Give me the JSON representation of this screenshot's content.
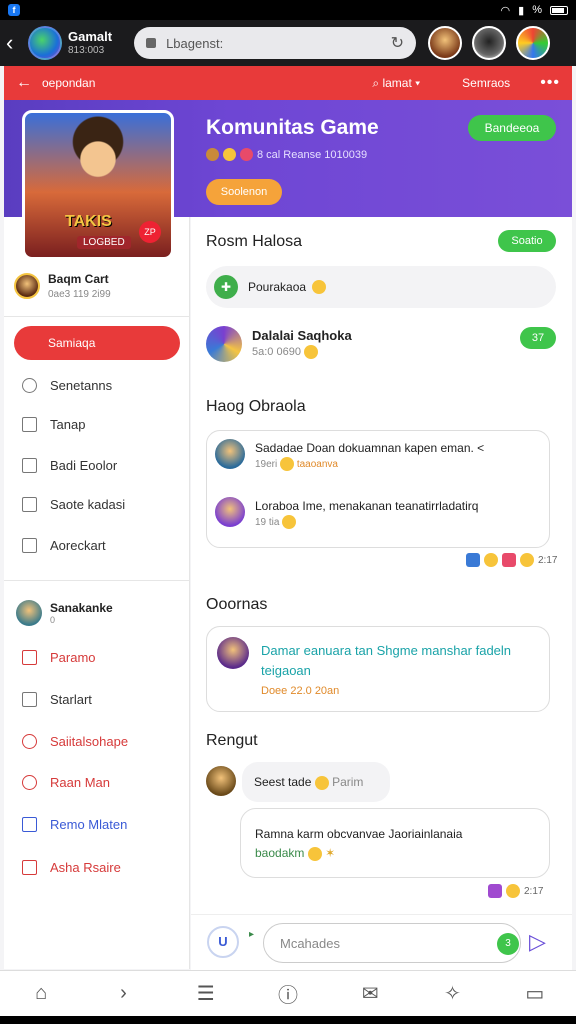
{
  "status_bar": {
    "app_badge": "f",
    "battery": "%"
  },
  "browser": {
    "app_name": "Gamalt",
    "app_sub": "813:003",
    "url": "Lbagenst:"
  },
  "header": {
    "back_label": "oepondan",
    "search_label": "lamat",
    "settings_label": "Semraos",
    "more_label": "•••"
  },
  "banner": {
    "title": "Komunitas Game",
    "join_label": "Bandeeoa",
    "stats": "8 cal Reanse 1010039",
    "genre_label": "Soolenon",
    "cover_game_name": "TAKIS",
    "cover_game_sub": "LOGBED",
    "cover_badge": "ZP"
  },
  "sidebar": {
    "user_name": "Baqm Cart",
    "user_stats": "0ae3 119 2i99",
    "primary_button": "Samiaqa",
    "items": [
      {
        "label": "Senetanns",
        "icon": "location-icon"
      },
      {
        "label": "Tanap",
        "icon": "mail-icon"
      },
      {
        "label": "Badi Eoolor",
        "icon": "list-icon"
      },
      {
        "label": "Saote kadasi",
        "icon": "document-icon"
      },
      {
        "label": "Aoreckart",
        "icon": "home-icon"
      }
    ],
    "section_user": "Sanakanke",
    "section_sub": "0",
    "section_items": [
      {
        "label": "Paramo",
        "icon": "home-icon",
        "color": "red"
      },
      {
        "label": "Starlart",
        "icon": "upload-icon",
        "color": "gray"
      },
      {
        "label": "Saiitalsohape",
        "icon": "clock-icon",
        "color": "red"
      },
      {
        "label": "Raan Man",
        "icon": "alert-icon",
        "color": "red"
      },
      {
        "label": "Remo Mlaten",
        "icon": "book-icon",
        "color": "blue"
      },
      {
        "label": "Asha Rsaire",
        "icon": "grid-icon",
        "color": "red"
      }
    ]
  },
  "main": {
    "section1_title": "Rosm Halosa",
    "section1_pill": "Soatio",
    "post_box_text": "Pourakaoa",
    "player_name": "Dalalai Saqhoka",
    "player_meta": "5a:0  0690",
    "player_pill": "37",
    "section2_title": "Haog Obraola",
    "chat": [
      {
        "message": "Sadadae Doan dokuamnan  kapen eman. <",
        "meta_prefix": "19eri",
        "meta_emph": "taaoanva"
      },
      {
        "message": "Loraboa Ime, menakanan teanatirrladatirq",
        "meta_prefix": "19 tia",
        "meta_emph": ""
      }
    ],
    "chat_reacts": "2:17",
    "section3_title": "Ooornas",
    "announce_message": "Damar eanuara tan Shgme manshar fadeln teigaoan",
    "announce_meta": "Doee 22.0  20an",
    "section4_title": "Rengut",
    "reply1": "Seest tade",
    "reply1_tail": "Parim",
    "reply2_line1": "Ramna karm obcvanvae Jaoriainlanaia",
    "reply2_line2": "baodakm",
    "reply_reacts": "2:17",
    "composer_placeholder": "Mcahades",
    "composer_badge": "3",
    "composer_plus": "U"
  },
  "colors": {
    "accent_red": "#e83a3a",
    "banner_purple": "#6e46d4",
    "green": "#3fc54b",
    "orange": "#f5a33a"
  }
}
